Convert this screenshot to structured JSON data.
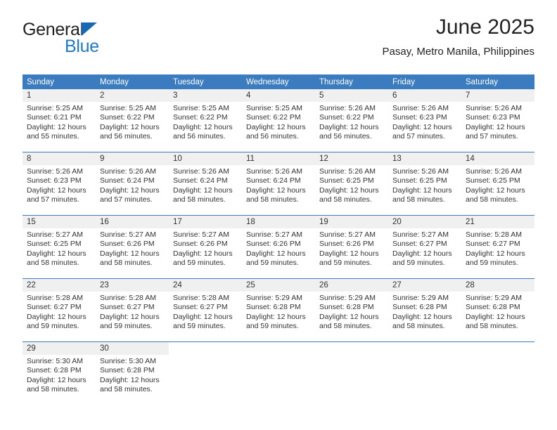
{
  "brand": {
    "name_top": "General",
    "name_bottom": "Blue",
    "flag_icon": "triangle-flag-icon",
    "accent_color": "#1f7ac4"
  },
  "header": {
    "title": "June 2025",
    "subtitle": "Pasay, Metro Manila, Philippines"
  },
  "theme": {
    "header_bg": "#3b7cc0",
    "daynum_bg": "#f0f0f0",
    "text": "#333333",
    "rule": "#3b7cc0"
  },
  "calendar": {
    "weekday_headers": [
      "Sunday",
      "Monday",
      "Tuesday",
      "Wednesday",
      "Thursday",
      "Friday",
      "Saturday"
    ],
    "labels": {
      "sunrise_prefix": "Sunrise:",
      "sunset_prefix": "Sunset:",
      "daylight_prefix": "Daylight:"
    },
    "weeks": [
      [
        {
          "day": "1",
          "sunrise": "Sunrise: 5:25 AM",
          "sunset": "Sunset: 6:21 PM",
          "daylight": "Daylight: 12 hours and 55 minutes."
        },
        {
          "day": "2",
          "sunrise": "Sunrise: 5:25 AM",
          "sunset": "Sunset: 6:22 PM",
          "daylight": "Daylight: 12 hours and 56 minutes."
        },
        {
          "day": "3",
          "sunrise": "Sunrise: 5:25 AM",
          "sunset": "Sunset: 6:22 PM",
          "daylight": "Daylight: 12 hours and 56 minutes."
        },
        {
          "day": "4",
          "sunrise": "Sunrise: 5:25 AM",
          "sunset": "Sunset: 6:22 PM",
          "daylight": "Daylight: 12 hours and 56 minutes."
        },
        {
          "day": "5",
          "sunrise": "Sunrise: 5:26 AM",
          "sunset": "Sunset: 6:22 PM",
          "daylight": "Daylight: 12 hours and 56 minutes."
        },
        {
          "day": "6",
          "sunrise": "Sunrise: 5:26 AM",
          "sunset": "Sunset: 6:23 PM",
          "daylight": "Daylight: 12 hours and 57 minutes."
        },
        {
          "day": "7",
          "sunrise": "Sunrise: 5:26 AM",
          "sunset": "Sunset: 6:23 PM",
          "daylight": "Daylight: 12 hours and 57 minutes."
        }
      ],
      [
        {
          "day": "8",
          "sunrise": "Sunrise: 5:26 AM",
          "sunset": "Sunset: 6:23 PM",
          "daylight": "Daylight: 12 hours and 57 minutes."
        },
        {
          "day": "9",
          "sunrise": "Sunrise: 5:26 AM",
          "sunset": "Sunset: 6:24 PM",
          "daylight": "Daylight: 12 hours and 57 minutes."
        },
        {
          "day": "10",
          "sunrise": "Sunrise: 5:26 AM",
          "sunset": "Sunset: 6:24 PM",
          "daylight": "Daylight: 12 hours and 58 minutes."
        },
        {
          "day": "11",
          "sunrise": "Sunrise: 5:26 AM",
          "sunset": "Sunset: 6:24 PM",
          "daylight": "Daylight: 12 hours and 58 minutes."
        },
        {
          "day": "12",
          "sunrise": "Sunrise: 5:26 AM",
          "sunset": "Sunset: 6:25 PM",
          "daylight": "Daylight: 12 hours and 58 minutes."
        },
        {
          "day": "13",
          "sunrise": "Sunrise: 5:26 AM",
          "sunset": "Sunset: 6:25 PM",
          "daylight": "Daylight: 12 hours and 58 minutes."
        },
        {
          "day": "14",
          "sunrise": "Sunrise: 5:26 AM",
          "sunset": "Sunset: 6:25 PM",
          "daylight": "Daylight: 12 hours and 58 minutes."
        }
      ],
      [
        {
          "day": "15",
          "sunrise": "Sunrise: 5:27 AM",
          "sunset": "Sunset: 6:25 PM",
          "daylight": "Daylight: 12 hours and 58 minutes."
        },
        {
          "day": "16",
          "sunrise": "Sunrise: 5:27 AM",
          "sunset": "Sunset: 6:26 PM",
          "daylight": "Daylight: 12 hours and 58 minutes."
        },
        {
          "day": "17",
          "sunrise": "Sunrise: 5:27 AM",
          "sunset": "Sunset: 6:26 PM",
          "daylight": "Daylight: 12 hours and 59 minutes."
        },
        {
          "day": "18",
          "sunrise": "Sunrise: 5:27 AM",
          "sunset": "Sunset: 6:26 PM",
          "daylight": "Daylight: 12 hours and 59 minutes."
        },
        {
          "day": "19",
          "sunrise": "Sunrise: 5:27 AM",
          "sunset": "Sunset: 6:26 PM",
          "daylight": "Daylight: 12 hours and 59 minutes."
        },
        {
          "day": "20",
          "sunrise": "Sunrise: 5:27 AM",
          "sunset": "Sunset: 6:27 PM",
          "daylight": "Daylight: 12 hours and 59 minutes."
        },
        {
          "day": "21",
          "sunrise": "Sunrise: 5:28 AM",
          "sunset": "Sunset: 6:27 PM",
          "daylight": "Daylight: 12 hours and 59 minutes."
        }
      ],
      [
        {
          "day": "22",
          "sunrise": "Sunrise: 5:28 AM",
          "sunset": "Sunset: 6:27 PM",
          "daylight": "Daylight: 12 hours and 59 minutes."
        },
        {
          "day": "23",
          "sunrise": "Sunrise: 5:28 AM",
          "sunset": "Sunset: 6:27 PM",
          "daylight": "Daylight: 12 hours and 59 minutes."
        },
        {
          "day": "24",
          "sunrise": "Sunrise: 5:28 AM",
          "sunset": "Sunset: 6:27 PM",
          "daylight": "Daylight: 12 hours and 59 minutes."
        },
        {
          "day": "25",
          "sunrise": "Sunrise: 5:29 AM",
          "sunset": "Sunset: 6:28 PM",
          "daylight": "Daylight: 12 hours and 59 minutes."
        },
        {
          "day": "26",
          "sunrise": "Sunrise: 5:29 AM",
          "sunset": "Sunset: 6:28 PM",
          "daylight": "Daylight: 12 hours and 58 minutes."
        },
        {
          "day": "27",
          "sunrise": "Sunrise: 5:29 AM",
          "sunset": "Sunset: 6:28 PM",
          "daylight": "Daylight: 12 hours and 58 minutes."
        },
        {
          "day": "28",
          "sunrise": "Sunrise: 5:29 AM",
          "sunset": "Sunset: 6:28 PM",
          "daylight": "Daylight: 12 hours and 58 minutes."
        }
      ],
      [
        {
          "day": "29",
          "sunrise": "Sunrise: 5:30 AM",
          "sunset": "Sunset: 6:28 PM",
          "daylight": "Daylight: 12 hours and 58 minutes."
        },
        {
          "day": "30",
          "sunrise": "Sunrise: 5:30 AM",
          "sunset": "Sunset: 6:28 PM",
          "daylight": "Daylight: 12 hours and 58 minutes."
        },
        {
          "day": "",
          "sunrise": "",
          "sunset": "",
          "daylight": ""
        },
        {
          "day": "",
          "sunrise": "",
          "sunset": "",
          "daylight": ""
        },
        {
          "day": "",
          "sunrise": "",
          "sunset": "",
          "daylight": ""
        },
        {
          "day": "",
          "sunrise": "",
          "sunset": "",
          "daylight": ""
        },
        {
          "day": "",
          "sunrise": "",
          "sunset": "",
          "daylight": ""
        }
      ]
    ]
  }
}
